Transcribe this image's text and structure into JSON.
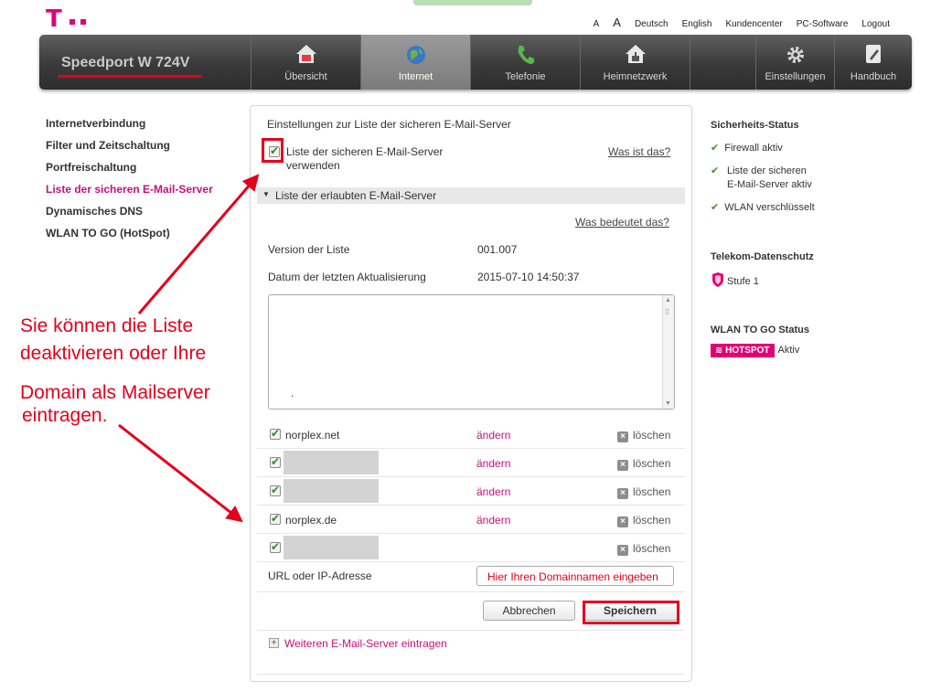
{
  "brand": {
    "logo": "T",
    "device": "Speedport W 724V"
  },
  "toplinks": [
    "A",
    "A",
    "Deutsch",
    "English",
    "Kundencenter",
    "PC-Software",
    "Logout"
  ],
  "nav": [
    {
      "label": "Übersicht",
      "icon": "home-icon"
    },
    {
      "label": "Internet",
      "icon": "globe-icon"
    },
    {
      "label": "Telefonie",
      "icon": "phone-icon"
    },
    {
      "label": "Heimnetzwerk",
      "icon": "home-network-icon"
    },
    {
      "label": "Einstellungen",
      "icon": "gear-icon"
    },
    {
      "label": "Handbuch",
      "icon": "book-icon"
    }
  ],
  "sidebar": [
    "Internetverbindung",
    "Filter und Zeitschaltung",
    "Portfreischaltung",
    "Liste der sicheren E-Mail-Server",
    "Dynamisches DNS",
    "WLAN TO GO (HotSpot)"
  ],
  "main": {
    "title": "Einstellungen zur Liste der sicheren E-Mail-Server",
    "use_list_label_1": "Liste der sicheren E-Mail-Server",
    "use_list_label_2": "verwenden",
    "what_is_that": "Was ist das?",
    "section_title": "Liste der erlaubten E-Mail-Server",
    "what_does_it_mean": "Was bedeutet das?",
    "version_label": "Version der Liste",
    "version_value": "001.007",
    "date_label": "Datum der letzten Aktualisierung",
    "date_value": "2015-07-10 14:50:37",
    "textarea_dot": ".",
    "servers": [
      "norplex.net",
      "",
      "",
      "norplex.de",
      ""
    ],
    "edit_label": "ändern",
    "delete_label": "löschen",
    "url_label": "URL oder IP-Adresse",
    "url_value": "Hier Ihren Domainnamen eingeben",
    "cancel": "Abbrechen",
    "save": "Speichern",
    "add_more": "Weiteren E-Mail-Server eintragen"
  },
  "status": {
    "security_title": "Sicherheits-Status",
    "firewall": "Firewall aktiv",
    "safe_list_1": "Liste der sicheren",
    "safe_list_2": "E-Mail-Server aktiv",
    "wlan": "WLAN verschlüsselt",
    "privacy_title": "Telekom-Datenschutz",
    "privacy_level": "Stufe 1",
    "hotspot_title": "WLAN TO GO Status",
    "hotspot_badge": "HOTSPOT",
    "hotspot_state": "Aktiv"
  },
  "annotations": {
    "line1": "Sie können die Liste",
    "line2": "deaktivieren oder Ihre",
    "line3": "Domain als Mailserver",
    "line4": "eintragen."
  },
  "colors": {
    "magenta": "#e20074",
    "annotation_red": "#e3001b",
    "check_green": "#2e8b2e"
  }
}
